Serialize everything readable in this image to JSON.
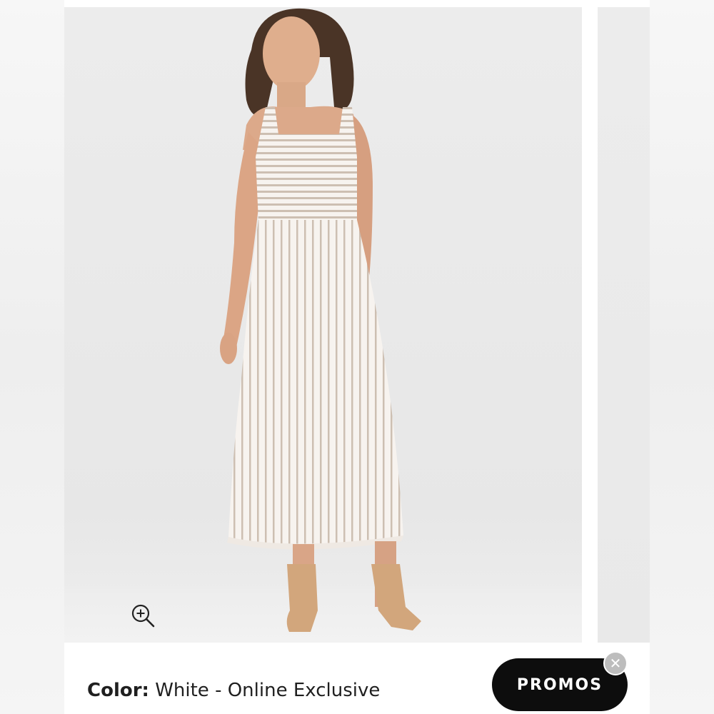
{
  "product": {
    "image_alt": "Model wearing white striped ribbed sleeveless midi dress",
    "zoom_icon": "zoom-in-icon",
    "color_label": "Color:",
    "color_value": " White  -  Online Exclusive"
  },
  "promos": {
    "label": "PROMOS",
    "close_icon": "close-icon",
    "close_glyph": "✕"
  },
  "colors": {
    "page_bg": "#f4f4f4",
    "photo_bg": "#e9e9e9",
    "dress": "#f6f2ee",
    "stripe": "#cdbfb2",
    "promos_bg": "#0d0d0d",
    "close_bg": "#bdbdbd"
  }
}
